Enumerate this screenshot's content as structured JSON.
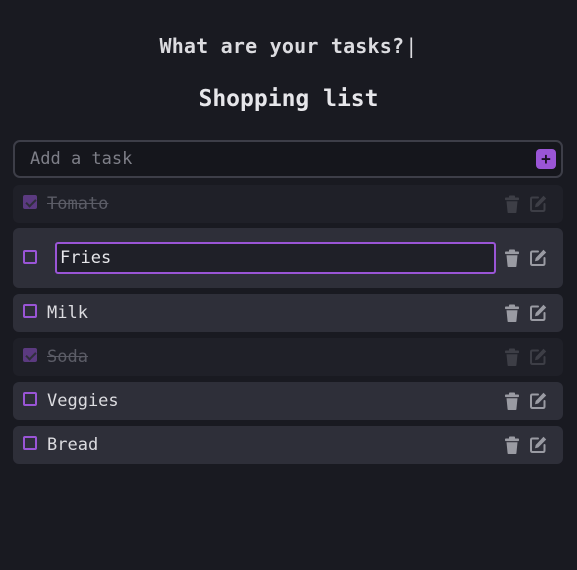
{
  "header": {
    "typed_text": "What are your tasks?",
    "caret": "|"
  },
  "list": {
    "title": "Shopping list"
  },
  "add_task": {
    "placeholder": "Add a task",
    "button_symbol": "+"
  },
  "tasks": [
    {
      "label": "Tomato",
      "done": true,
      "editing": false
    },
    {
      "label": "Fries",
      "done": false,
      "editing": true
    },
    {
      "label": "Milk",
      "done": false,
      "editing": false
    },
    {
      "label": "Soda",
      "done": true,
      "editing": false
    },
    {
      "label": "Veggies",
      "done": false,
      "editing": false
    },
    {
      "label": "Bread",
      "done": false,
      "editing": false
    }
  ],
  "icons": {
    "delete": "trash-icon",
    "edit": "edit-icon",
    "add": "plus-icon"
  },
  "colors": {
    "background": "#191a21",
    "row": "#2e2f39",
    "row_done": "#1f2028",
    "accent": "#9a55d6",
    "text": "#dcdce0",
    "icon": "#9a9ba3",
    "icon_done": "#3d3e46"
  }
}
